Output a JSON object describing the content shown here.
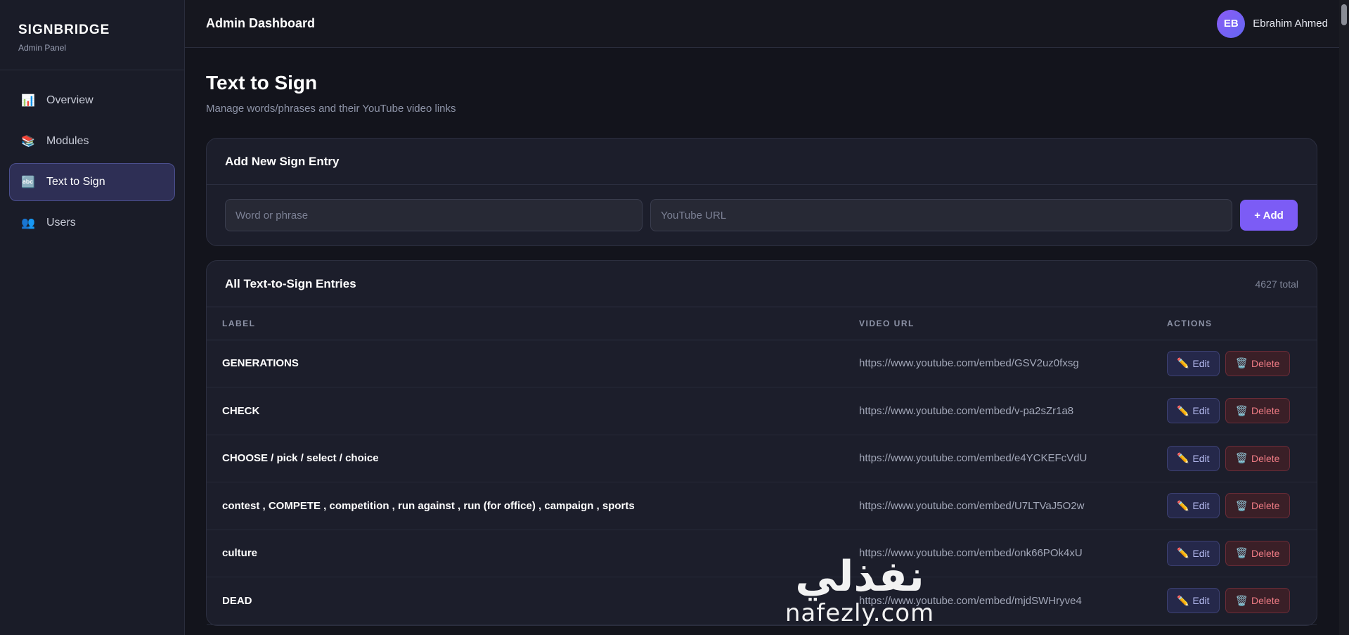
{
  "brand": {
    "title": "SIGNBRIDGE",
    "subtitle": "Admin Panel"
  },
  "sidebar": {
    "items": [
      {
        "label": "Overview",
        "icon": "📊"
      },
      {
        "label": "Modules",
        "icon": "📚"
      },
      {
        "label": "Text to Sign",
        "icon": "🔤",
        "active": true
      },
      {
        "label": "Users",
        "icon": "👥"
      }
    ]
  },
  "header": {
    "title": "Admin Dashboard",
    "user": {
      "initials": "EB",
      "name": "Ebrahim Ahmed"
    }
  },
  "page": {
    "title": "Text to Sign",
    "subtitle": "Manage words/phrases and their YouTube video links"
  },
  "add_form": {
    "title": "Add New Sign Entry",
    "word_placeholder": "Word or phrase",
    "url_placeholder": "YouTube URL",
    "add_label": "+ Add"
  },
  "entries": {
    "title": "All Text-to-Sign Entries",
    "total": "4627 total",
    "columns": [
      "LABEL",
      "VIDEO URL",
      "ACTIONS"
    ],
    "edit_label": "Edit",
    "delete_label": "Delete",
    "rows": [
      {
        "label": "GENERATIONS",
        "url": "https://www.youtube.com/embed/GSV2uz0fxsg"
      },
      {
        "label": "CHECK",
        "url": "https://www.youtube.com/embed/v-pa2sZr1a8"
      },
      {
        "label": "CHOOSE / pick / select / choice",
        "url": "https://www.youtube.com/embed/e4YCKEFcVdU"
      },
      {
        "label": "contest , COMPETE , competition , run against , run (for office) , campaign , sports",
        "url": "https://www.youtube.com/embed/U7LTVaJ5O2w"
      },
      {
        "label": "culture",
        "url": "https://www.youtube.com/embed/onk66POk4xU"
      },
      {
        "label": "DEAD",
        "url": "https://www.youtube.com/embed/mjdSWHryve4"
      }
    ]
  },
  "watermark": {
    "arabic": "نفذلي",
    "latin": "nafezly.com"
  },
  "colors": {
    "accent": "#7c5cf5",
    "danger": "#f07c85",
    "background": "#13141c"
  }
}
